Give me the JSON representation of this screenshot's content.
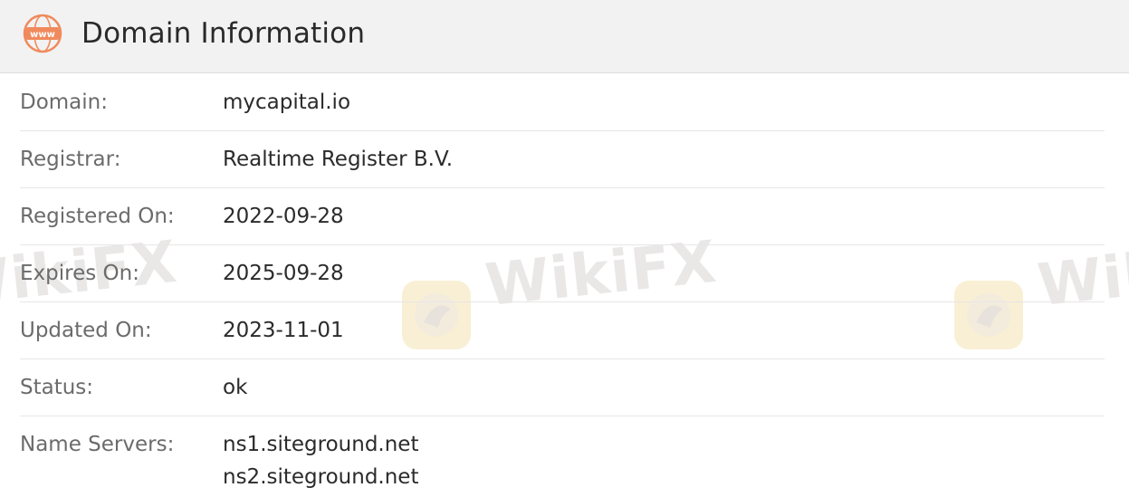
{
  "header": {
    "title": "Domain Information",
    "icon_text": "www",
    "icon_color": "#f08a5d"
  },
  "rows": [
    {
      "label": "Domain:",
      "values": [
        "mycapital.io"
      ]
    },
    {
      "label": "Registrar:",
      "values": [
        "Realtime Register B.V."
      ]
    },
    {
      "label": "Registered On:",
      "values": [
        "2022-09-28"
      ]
    },
    {
      "label": "Expires On:",
      "values": [
        "2025-09-28"
      ]
    },
    {
      "label": "Updated On:",
      "values": [
        "2023-11-01"
      ]
    },
    {
      "label": "Status:",
      "values": [
        "ok"
      ]
    },
    {
      "label": "Name Servers:",
      "values": [
        "ns1.siteground.net",
        "ns2.siteground.net"
      ]
    }
  ],
  "watermark": {
    "text": "WikiFX",
    "logo_color": "#f6e6b8"
  }
}
